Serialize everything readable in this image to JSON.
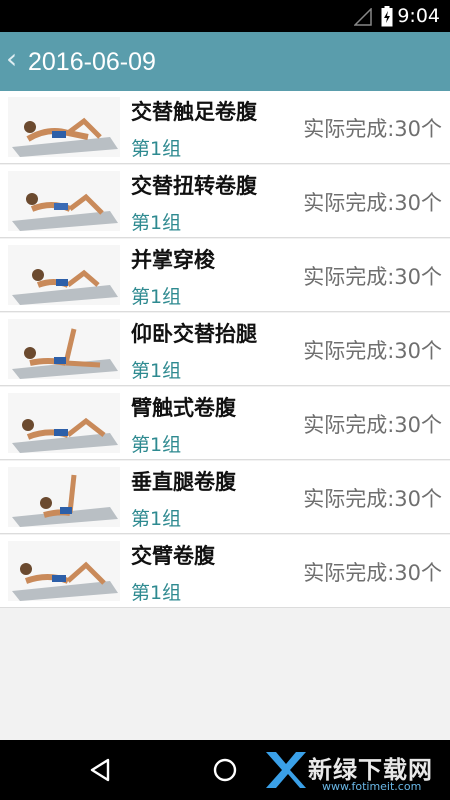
{
  "status_bar": {
    "time": "9:04"
  },
  "app_bar": {
    "back_icon": "‹",
    "title": "2016-06-09"
  },
  "exercises": [
    {
      "name": "交替触足卷腹",
      "group": "第1组",
      "done": "实际完成:30个",
      "pose": "crunch"
    },
    {
      "name": "交替扭转卷腹",
      "group": "第1组",
      "done": "实际完成:30个",
      "pose": "twist"
    },
    {
      "name": "并掌穿梭",
      "group": "第1组",
      "done": "实际完成:30个",
      "pose": "reach"
    },
    {
      "name": "仰卧交替抬腿",
      "group": "第1组",
      "done": "实际完成:30个",
      "pose": "legraise"
    },
    {
      "name": "臂触式卷腹",
      "group": "第1组",
      "done": "实际完成:30个",
      "pose": "armtouch"
    },
    {
      "name": "垂直腿卷腹",
      "group": "第1组",
      "done": "实际完成:30个",
      "pose": "vertical"
    },
    {
      "name": "交臂卷腹",
      "group": "第1组",
      "done": "实际完成:30个",
      "pose": "crossarm"
    }
  ],
  "watermark": {
    "text": "新绿下载网",
    "url": "www.fotimeit.com"
  },
  "colors": {
    "app_bar": "#5a9dac",
    "group_text": "#2e8a90",
    "done_text": "#6f6f6f"
  }
}
